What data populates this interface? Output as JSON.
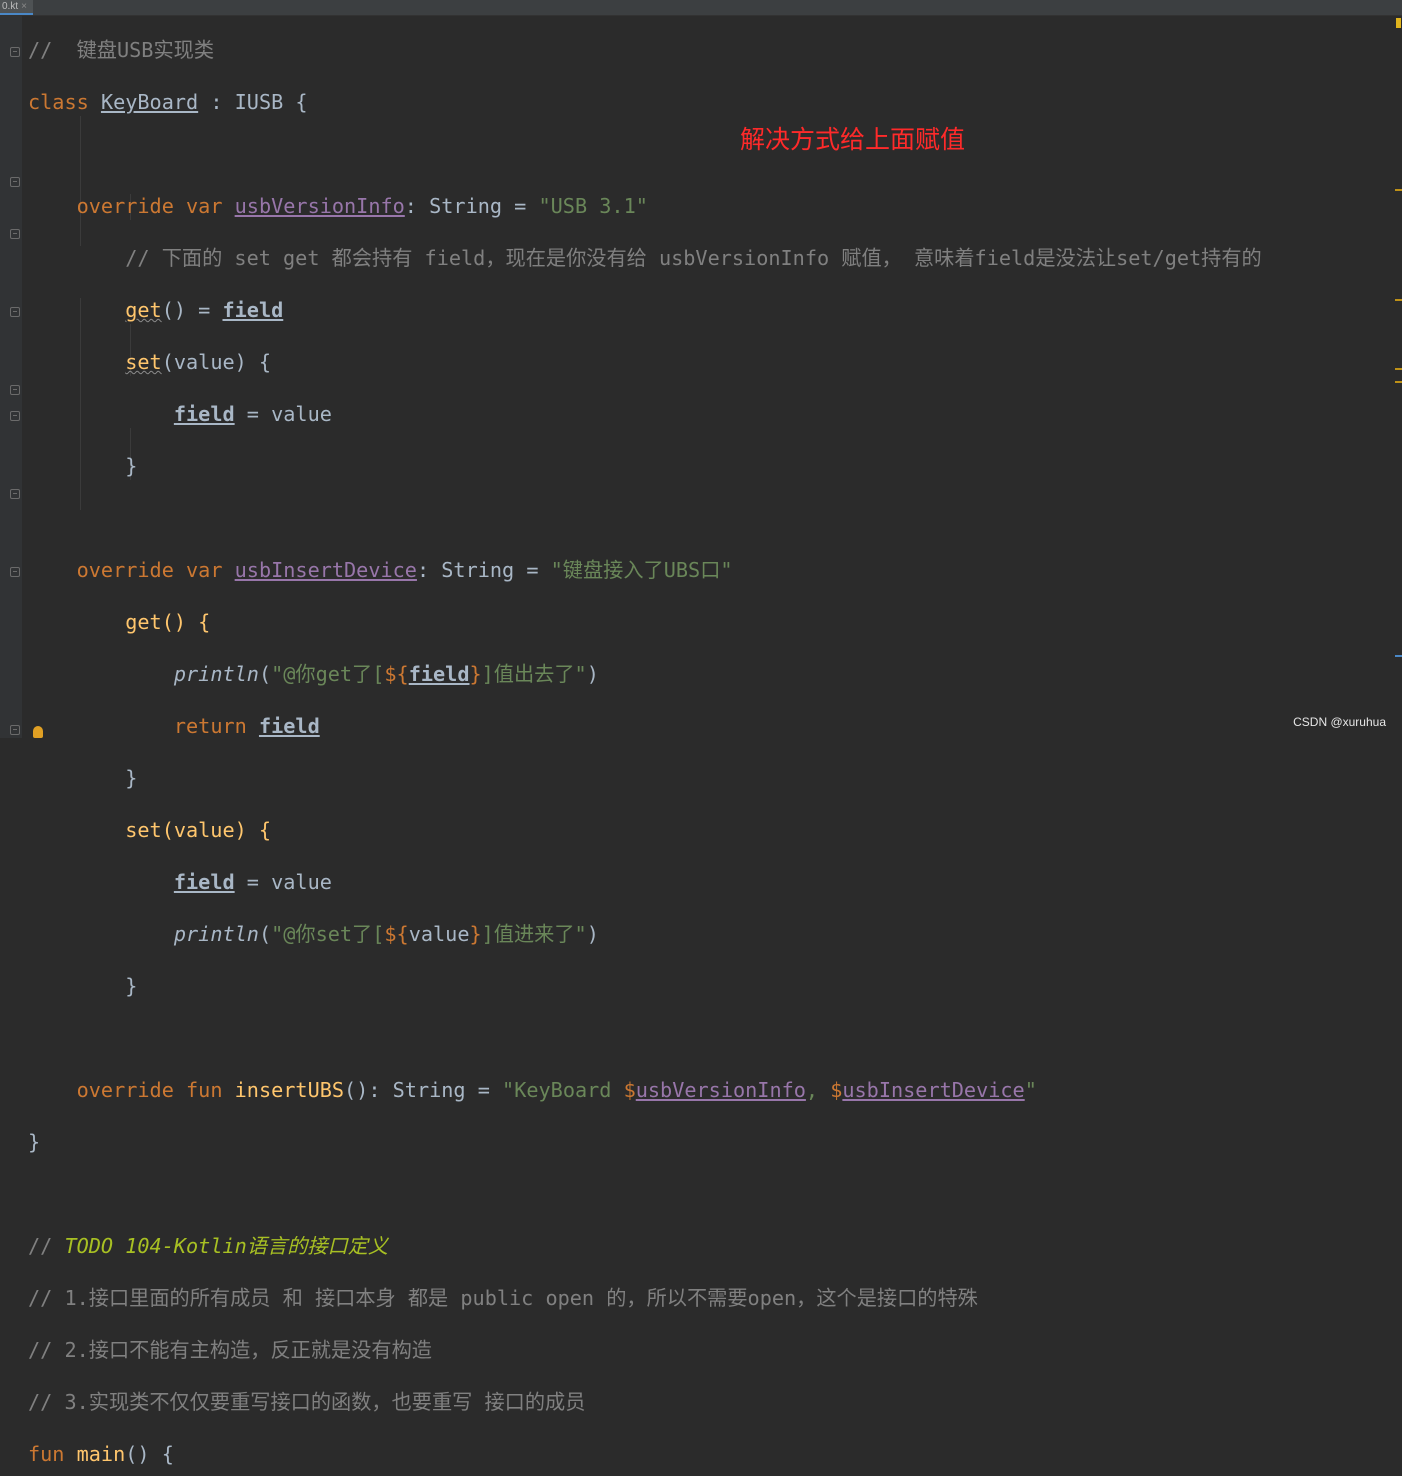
{
  "tab": {
    "filename": "0.kt",
    "close": "×"
  },
  "code": {
    "l0": "//  键盘USB实现类",
    "l1_kw": "class",
    "l1_name": "KeyBoard",
    "l1_rest": " : IUSB {",
    "l3_kw": "override var",
    "l3_prop": "usbVersionInfo",
    "l3_type": ": String = ",
    "l3_str": "\"USB 3.1\"",
    "l4": "// 下面的 set get 都会持有 field，现在是你没有给 usbVersionInfo 赋值， 意味着field是没法让set/get持有的",
    "l5_get": "get",
    "l5_rest": "() = ",
    "l5_field": "field",
    "l6_set": "set",
    "l6_rest": "(value) {",
    "l7_field": "field",
    "l7_rest": " = value",
    "l8": "}",
    "l10_kw": "override var",
    "l10_prop": "usbInsertDevice",
    "l10_type": ": String = ",
    "l10_str": "\"键盘接入了UBS口\"",
    "l11": "get() {",
    "l12_fn": "println",
    "l12_a": "(",
    "l12_s1": "\"@你get了[",
    "l12_t1": "${",
    "l12_field": "field",
    "l12_t2": "}",
    "l12_s2": "]值出去了\"",
    "l12_b": ")",
    "l13_kw": "return",
    "l13_field": "field",
    "l14": "}",
    "l15": "set(value) {",
    "l16_field": "field",
    "l16_rest": " = value",
    "l17_fn": "println",
    "l17_a": "(",
    "l17_s1": "\"@你set了[",
    "l17_t1": "${",
    "l17_val": "value",
    "l17_t2": "}",
    "l17_s2": "]值进来了\"",
    "l17_b": ")",
    "l18": "}",
    "l20_kw": "override fun",
    "l20_fn": "insertUBS",
    "l20_type": "(): String = ",
    "l20_s1": "\"KeyBoard ",
    "l20_d1": "$",
    "l20_p1": "usbVersionInfo",
    "l20_s2": ", ",
    "l20_d2": "$",
    "l20_p2": "usbInsertDevice",
    "l20_s3": "\"",
    "l21": "}",
    "l23_c": "// ",
    "l23_todo": "TODO 104-Kotlin语言的接口定义",
    "l24": "// 1.接口里面的所有成员 和 接口本身 都是 public open 的，所以不需要open，这个是接口的特殊",
    "l25": "// 2.接口不能有主构造，反正就是没有构造",
    "l26": "// 3.实现类不仅仅要重写接口的函数，也要重写 接口的成员",
    "l27_kw": "fun",
    "l27_fn": "main",
    "l27_rest": "() {"
  },
  "annotation": "解决方式给上面赋值",
  "watermark": "CSDN @xuruhua",
  "colors": {
    "background": "#2b2b2b",
    "keyword": "#cc7832",
    "string": "#6a8759",
    "comment": "#808080",
    "property": "#9876aa",
    "function": "#ffc66d",
    "todo": "#a8c023",
    "annotation": "#ff2a2a"
  }
}
